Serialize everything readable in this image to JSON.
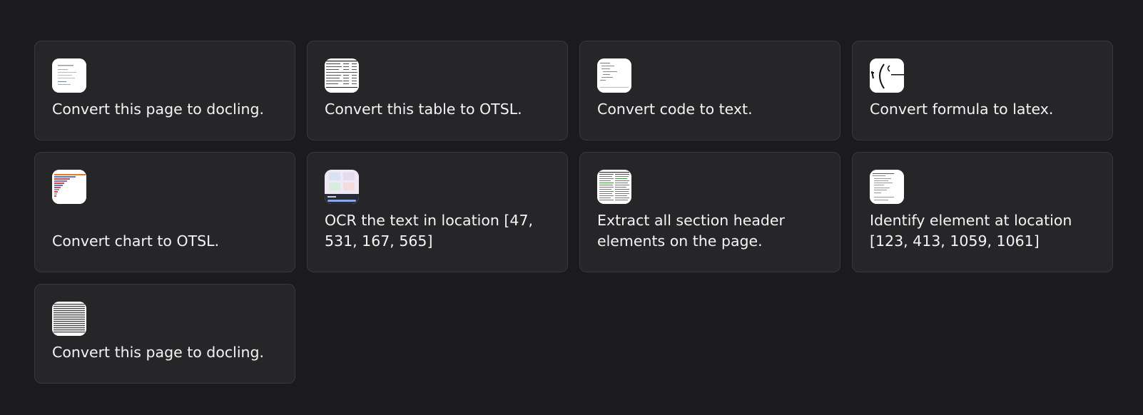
{
  "cards": [
    {
      "label": "Convert this page to docling.",
      "icon": "document-page-thumbnail-icon"
    },
    {
      "label": "Convert this table to OTSL.",
      "icon": "table-thumbnail-icon"
    },
    {
      "label": "Convert code to text.",
      "icon": "code-thumbnail-icon"
    },
    {
      "label": "Convert formula to latex.",
      "icon": "formula-thumbnail-icon"
    },
    {
      "label": "Convert chart to OTSL.",
      "icon": "chart-thumbnail-icon"
    },
    {
      "label": "OCR the text in location [47, 531, 167, 565]",
      "icon": "ui-screenshot-thumbnail-icon"
    },
    {
      "label": "Extract all section header elements on the page.",
      "icon": "dense-page-thumbnail-icon"
    },
    {
      "label": "Identify element at location [123, 413, 1059, 1061]",
      "icon": "text-page-thumbnail-icon"
    },
    {
      "label": "Convert this page to docling.",
      "icon": "dense-document-thumbnail-icon"
    }
  ],
  "colors": {
    "background": "#1b1b1d",
    "card": "#262628",
    "border": "#38383b",
    "text": "#f4f4f4"
  }
}
